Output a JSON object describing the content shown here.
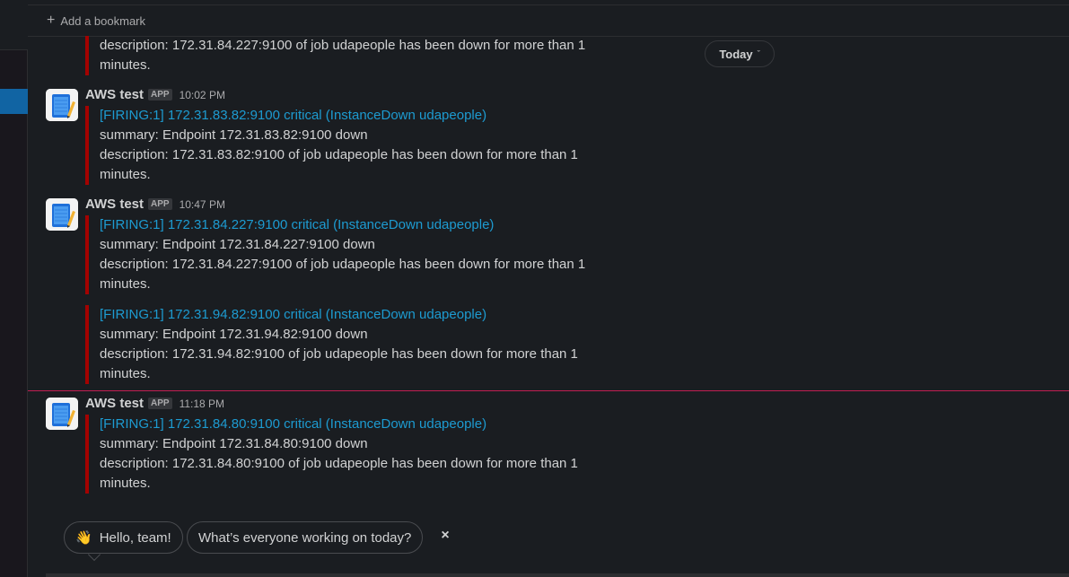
{
  "bookmark_bar": {
    "plus": "+",
    "label": "Add a bookmark"
  },
  "date_divider": {
    "label": "Today",
    "chevron": "ˇ"
  },
  "colors": {
    "alert_bar": "#a30200",
    "link": "#1d9bd1",
    "new_divider": "#e01e5a",
    "selected_channel": "#1164a3"
  },
  "messages": [
    {
      "attachments": [
        {
          "lines": [
            "description: 172.31.84.227:9100 of job udapeople has been down for more than 1",
            "minutes."
          ]
        }
      ]
    },
    {
      "sender": "AWS test",
      "badge": "APP",
      "time": "10:02 PM",
      "avatar_icon": "notepad-pencil-icon",
      "attachments": [
        {
          "title": "[FIRING:1] 172.31.83.82:9100 critical (InstanceDown udapeople)",
          "lines": [
            "summary: Endpoint 172.31.83.82:9100 down",
            "description: 172.31.83.82:9100 of job udapeople has been down for more than 1",
            "minutes."
          ]
        }
      ]
    },
    {
      "sender": "AWS test",
      "badge": "APP",
      "time": "10:47 PM",
      "avatar_icon": "notepad-pencil-icon",
      "attachments": [
        {
          "title": "[FIRING:1] 172.31.84.227:9100 critical (InstanceDown udapeople)",
          "lines": [
            "summary: Endpoint 172.31.84.227:9100 down",
            "description: 172.31.84.227:9100 of job udapeople has been down for more than 1",
            "minutes."
          ]
        },
        {
          "title": "[FIRING:1] 172.31.94.82:9100 critical (InstanceDown udapeople)",
          "lines": [
            "summary: Endpoint 172.31.94.82:9100 down",
            "description: 172.31.94.82:9100 of job udapeople has been down for more than 1",
            "minutes."
          ]
        }
      ]
    },
    {
      "sender": "AWS test",
      "badge": "APP",
      "time": "11:18 PM",
      "avatar_icon": "notepad-pencil-icon",
      "attachments": [
        {
          "title": "[FIRING:1] 172.31.84.80:9100 critical (InstanceDown udapeople)",
          "lines": [
            "summary: Endpoint 172.31.84.80:9100 down",
            "description: 172.31.84.80:9100 of job udapeople has been down for more than 1",
            "minutes."
          ]
        }
      ]
    }
  ],
  "suggestions": {
    "hello": "Hello, team!",
    "hello_emoji": "👋",
    "working": "What’s everyone working on today?",
    "dismiss": "×"
  }
}
